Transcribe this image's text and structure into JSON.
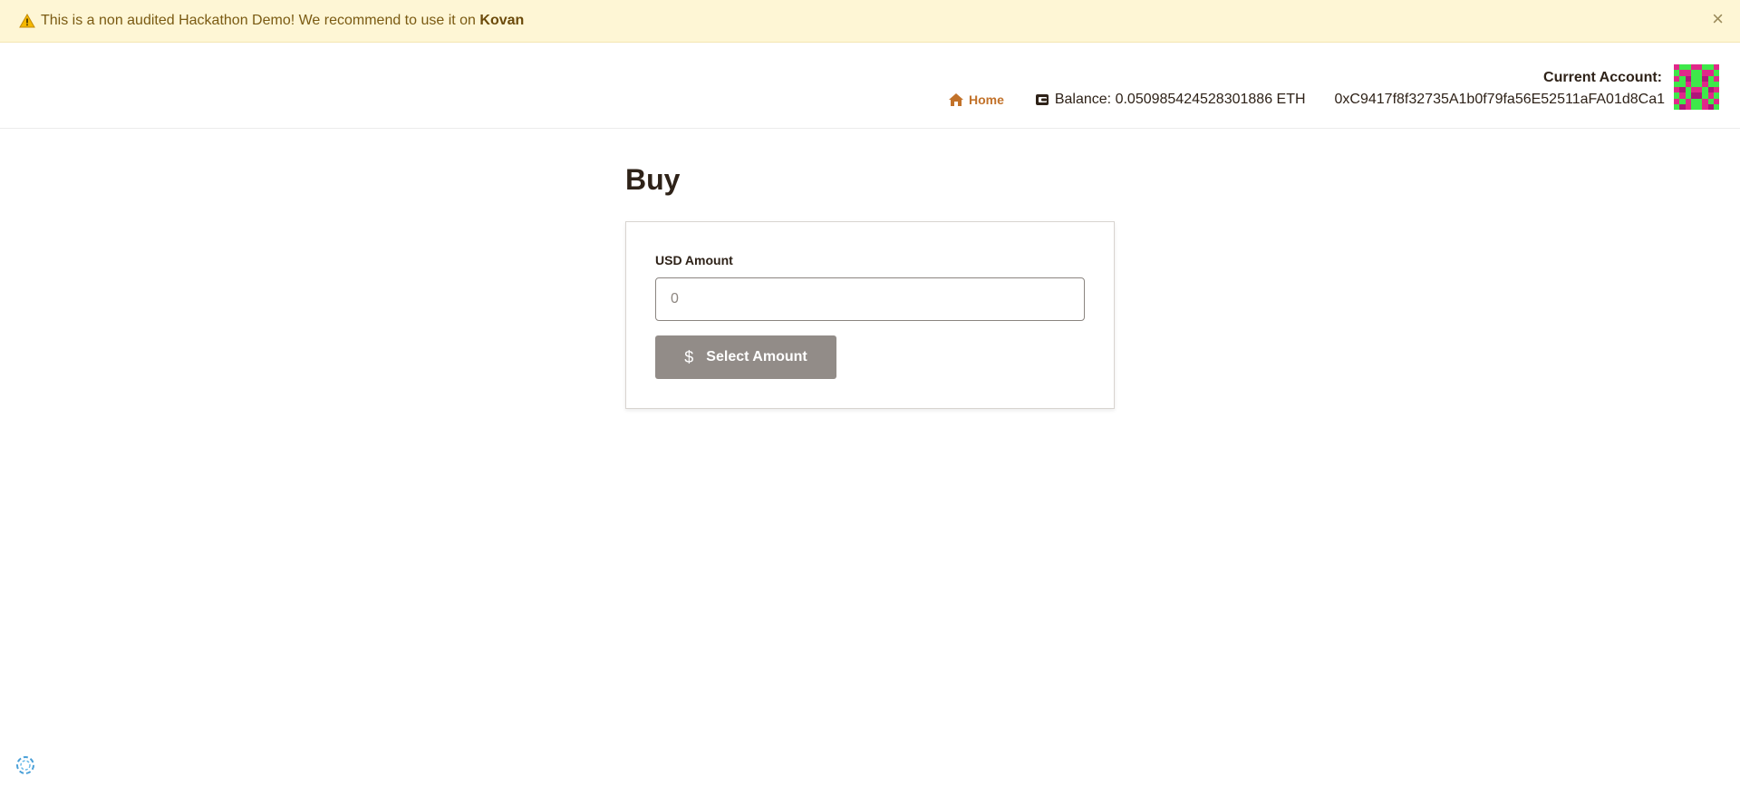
{
  "banner": {
    "icon": "warning-icon",
    "text": "This is a non audited Hackathon Demo! We recommend to use it on",
    "network": "Kovan",
    "close": "×"
  },
  "header": {
    "account_label": "Current Account:",
    "nav": {
      "home_label": "Home",
      "home_icon": "home-icon",
      "balance_icon": "wallet-icon",
      "balance_text": "Balance: 0.050985424528301886 ETH",
      "address": "0xC9417f8f32735A1b0f79fa56E52511aFA01d8Ca1"
    },
    "avatar_colors": {
      "pink": "#e0288a",
      "green": "#3ee84a",
      "dark": "#b0157a"
    }
  },
  "main": {
    "title": "Buy",
    "form": {
      "field_label": "USD Amount",
      "input_placeholder": "0",
      "button_icon": "dollar-icon",
      "button_label": "Select Amount"
    }
  },
  "colors": {
    "accent": "#c2722a",
    "banner_bg": "#fef6d5",
    "button_bg": "#928c88"
  }
}
